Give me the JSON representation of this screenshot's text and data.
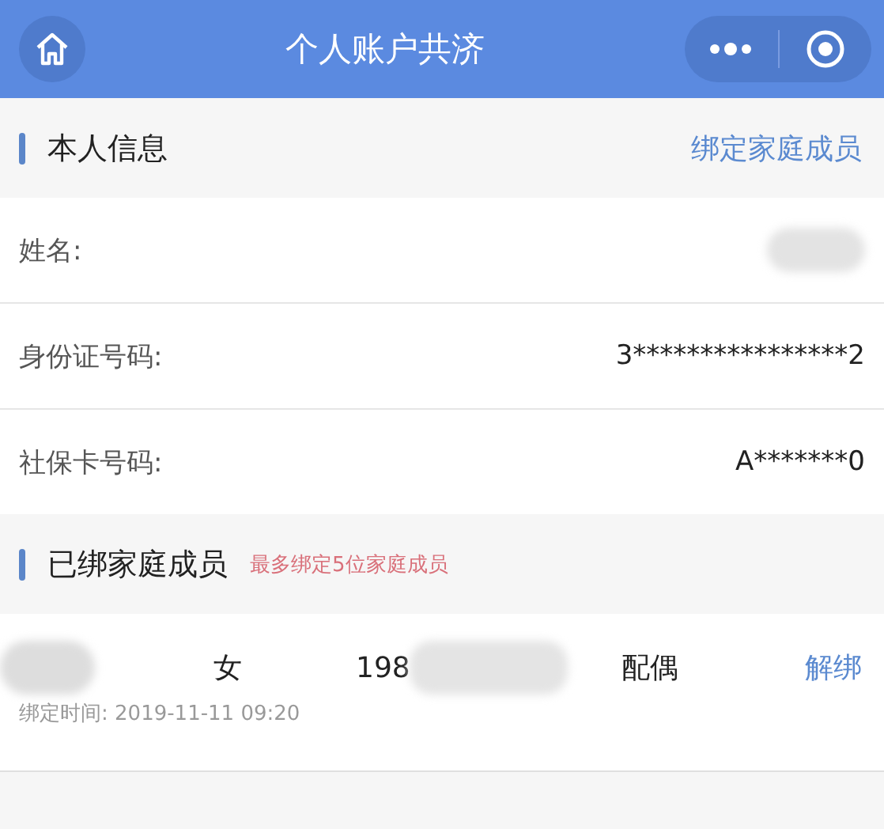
{
  "header": {
    "title": "个人账户共济"
  },
  "self_section": {
    "title": "本人信息",
    "action": "绑定家庭成员"
  },
  "fields": [
    {
      "label": "姓名:",
      "redacted": true
    },
    {
      "label": "身份证号码:",
      "value": "3****************2",
      "redacted": false
    },
    {
      "label": "社保卡号码:",
      "value": "A*******0",
      "redacted": false
    }
  ],
  "members_section": {
    "title": "已绑家庭成员",
    "note": "最多绑定5位家庭成员"
  },
  "members": [
    {
      "name_redacted": true,
      "gender": "女",
      "birth": "198",
      "birth_redacted": true,
      "relation": "配偶",
      "action": "解绑",
      "bind_time_label": "绑定时间:",
      "bind_time": "2019-11-11 09:20"
    }
  ]
}
